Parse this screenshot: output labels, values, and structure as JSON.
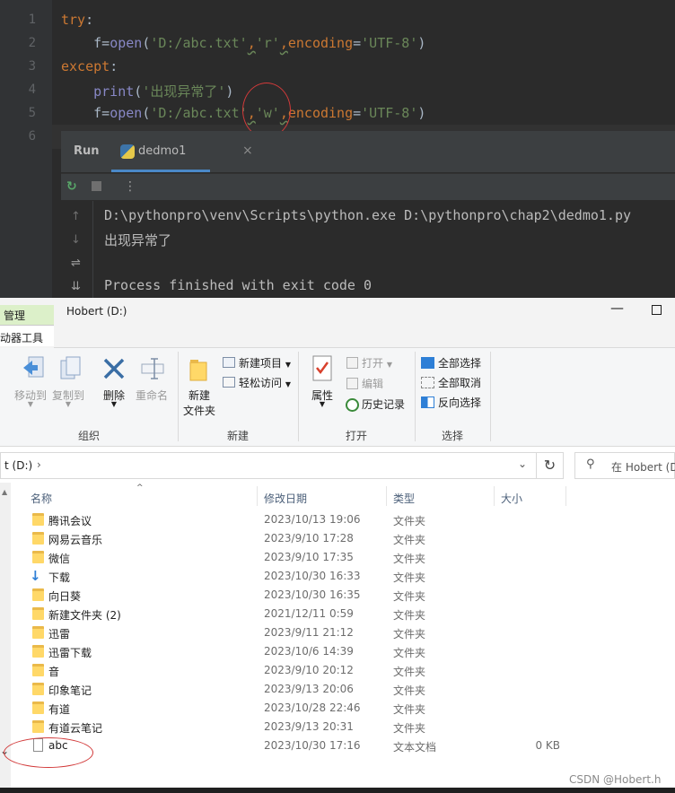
{
  "editor": {
    "line_numbers": [
      "1",
      "2",
      "3",
      "4",
      "5",
      "6"
    ],
    "line1_kw": "try",
    "line1_rest": ":",
    "line2_indent": "    f=",
    "line2_fn": "open",
    "line2_p1": "(",
    "line2_s1": "'D:/abc.txt'",
    "line2_c1": ",",
    "line2_s2": "'r'",
    "line2_c2": ",",
    "line2_kwarg": "encoding",
    "line2_eq": "=",
    "line2_s3": "'UTF-8'",
    "line2_p2": ")",
    "line3_kw": "except",
    "line3_rest": ":",
    "line4_indent": "    ",
    "line4_fn": "print",
    "line4_p1": "(",
    "line4_s1": "'出现异常了'",
    "line4_p2": ")",
    "line5_indent": "    f=",
    "line5_fn": "open",
    "line5_p1": "(",
    "line5_s1": "'D:/abc.txt'",
    "line5_c1": ",",
    "line5_s2": "'w'",
    "line5_c2": ",",
    "line5_kwarg": "encoding",
    "line5_eq": "=",
    "line5_s3": "'UTF-8'",
    "line5_p2": ")"
  },
  "run_panel": {
    "title": "Run",
    "tab_label": "dedmo1",
    "close_glyph": "×",
    "console": [
      "D:\\pythonpro\\venv\\Scripts\\python.exe D:\\pythonpro\\chap2\\dedmo1.py",
      "出现异常了",
      "",
      "Process finished with exit code 0"
    ]
  },
  "explorer": {
    "manage_tab": "管理",
    "drive_tools_tab": "动器工具",
    "window_title": "Hobert (D:)",
    "minimize_glyph": "—",
    "ribbon": {
      "move_to": "移动到",
      "copy_to": "复制到",
      "delete": "删除",
      "rename": "重命名",
      "new_folder_line1": "新建",
      "new_folder_line2": "文件夹",
      "new_item": "新建项目",
      "easy_access": "轻松访问",
      "properties": "属性",
      "open": "打开",
      "edit": "编辑",
      "history": "历史记录",
      "select_all": "全部选择",
      "select_none": "全部取消",
      "invert_selection": "反向选择",
      "group_organize": "组织",
      "group_new": "新建",
      "group_open": "打开",
      "group_select": "选择"
    },
    "address": {
      "text": "t (D:)",
      "chevron": "›",
      "search_placeholder": "在 Hobert (D:"
    },
    "columns": {
      "name": "名称",
      "modified": "修改日期",
      "type": "类型",
      "size": "大小"
    },
    "files": [
      {
        "name": "腾讯会议",
        "date": "2023/10/13 19:06",
        "type": "文件夹",
        "size": "",
        "icon": "folder-icon"
      },
      {
        "name": "网易云音乐",
        "date": "2023/9/10 17:28",
        "type": "文件夹",
        "size": "",
        "icon": "folder-icon"
      },
      {
        "name": "微信",
        "date": "2023/9/10 17:35",
        "type": "文件夹",
        "size": "",
        "icon": "folder-icon"
      },
      {
        "name": "下载",
        "date": "2023/10/30 16:33",
        "type": "文件夹",
        "size": "",
        "icon": "download-icon"
      },
      {
        "name": "向日葵",
        "date": "2023/10/30 16:35",
        "type": "文件夹",
        "size": "",
        "icon": "folder-icon"
      },
      {
        "name": "新建文件夹 (2)",
        "date": "2021/12/11 0:59",
        "type": "文件夹",
        "size": "",
        "icon": "folder-icon"
      },
      {
        "name": "迅雷",
        "date": "2023/9/11 21:12",
        "type": "文件夹",
        "size": "",
        "icon": "folder-icon"
      },
      {
        "name": "迅雷下载",
        "date": "2023/10/6 14:39",
        "type": "文件夹",
        "size": "",
        "icon": "folder-icon"
      },
      {
        "name": "音",
        "date": "2023/9/10 20:12",
        "type": "文件夹",
        "size": "",
        "icon": "folder-icon"
      },
      {
        "name": "印象笔记",
        "date": "2023/9/13 20:06",
        "type": "文件夹",
        "size": "",
        "icon": "folder-icon"
      },
      {
        "name": "有道",
        "date": "2023/10/28 22:46",
        "type": "文件夹",
        "size": "",
        "icon": "folder-icon"
      },
      {
        "name": "有道云笔记",
        "date": "2023/9/13 20:31",
        "type": "文件夹",
        "size": "",
        "icon": "folder-icon"
      },
      {
        "name": "abc",
        "date": "2023/10/30 17:16",
        "type": "文本文档",
        "size": "0 KB",
        "icon": "text-file-icon"
      }
    ]
  },
  "watermark": "CSDN @Hobert.h",
  "colors": {
    "ide_bg": "#2b2b2b",
    "keyword": "#cc7832",
    "string": "#6a8759",
    "annotation_red": "#d23a3a",
    "folder_yellow": "#ffd868",
    "manage_tab_green": "#dcf0c9"
  }
}
